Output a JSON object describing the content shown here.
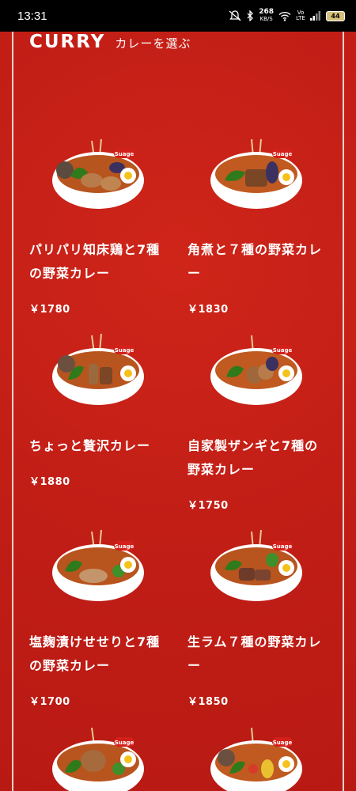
{
  "status": {
    "time": "13:31",
    "speed_value": "268",
    "speed_unit": "KB/S",
    "volte": "Vo LTE",
    "battery": "44"
  },
  "header": {
    "title_en": "CURRY",
    "title_jp": "カレーを選ぶ"
  },
  "badge": "Suage",
  "items": [
    {
      "name": "パリパリ知床鶏と7種の野菜カレー",
      "price": "￥1780"
    },
    {
      "name": "角煮と７種の野菜カレー",
      "price": "￥1830"
    },
    {
      "name": "ちょっと贅沢カレー",
      "price": "￥1880"
    },
    {
      "name": "自家製ザンギと7種の野菜カレー",
      "price": "￥1750"
    },
    {
      "name": "塩麹漬けせせりと7種の野菜カレー",
      "price": "￥1700"
    },
    {
      "name": "生ラム７種の野菜カレー",
      "price": "￥1850"
    }
  ]
}
